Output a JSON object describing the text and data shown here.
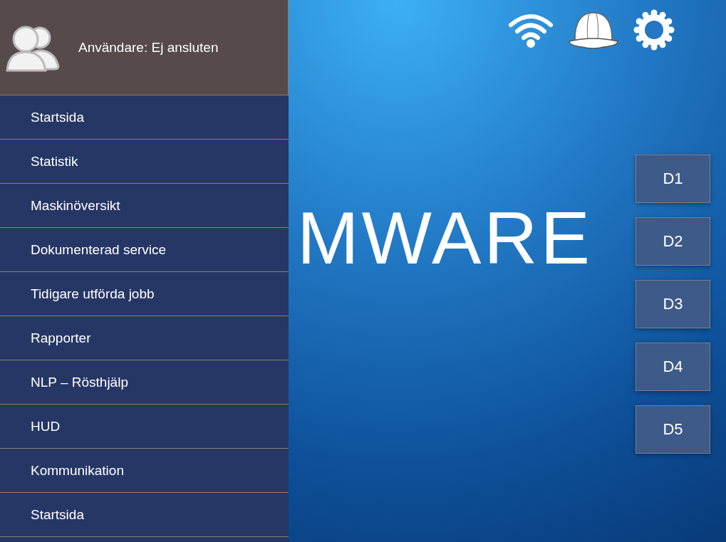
{
  "sidebar": {
    "user_label": "Användare: Ej ansluten",
    "items": [
      {
        "label": "Startsida"
      },
      {
        "label": "Statistik"
      },
      {
        "label": "Maskinöversikt"
      },
      {
        "label": "Dokumenterad service"
      },
      {
        "label": "Tidigare utförda jobb"
      },
      {
        "label": "Rapporter"
      },
      {
        "label": "NLP – Rösthjälp"
      },
      {
        "label": "HUD"
      },
      {
        "label": "Kommunikation"
      },
      {
        "label": "Startsida"
      }
    ]
  },
  "main": {
    "title": "MWARE",
    "buttons": [
      {
        "label": "D1"
      },
      {
        "label": "D2"
      },
      {
        "label": "D3"
      },
      {
        "label": "D4"
      },
      {
        "label": "D5"
      }
    ]
  }
}
